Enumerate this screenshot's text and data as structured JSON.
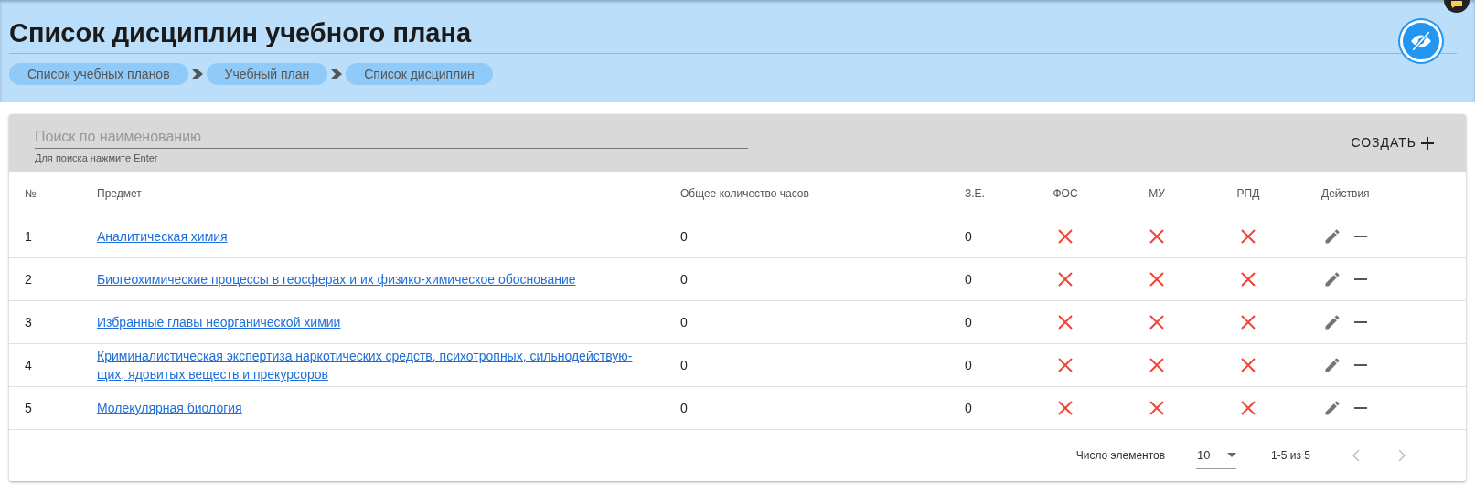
{
  "page_title": "Список дисциплин учебного плана",
  "breadcrumbs": [
    {
      "label": "Список учебных планов"
    },
    {
      "label": "Учебный план"
    },
    {
      "label": "Список дисциплин"
    }
  ],
  "search": {
    "placeholder": "Поиск по наименованию",
    "hint": "Для поиска нажмите Enter"
  },
  "create_button": "СОЗДАТЬ",
  "table": {
    "columns": [
      "№",
      "Предмет",
      "Общее количество часов",
      "З.Е.",
      "ФОС",
      "МУ",
      "РПД",
      "Действия"
    ],
    "rows": [
      {
        "number": "1",
        "subject": "Аналитическая химия",
        "hours": "0",
        "credits": "0",
        "fos": false,
        "mu": false,
        "rpd": false
      },
      {
        "number": "2",
        "subject": "Биогеохимические процессы в геосферах и их физико-химическое обоснование",
        "hours": "0",
        "credits": "0",
        "fos": false,
        "mu": false,
        "rpd": false
      },
      {
        "number": "3",
        "subject": "Избранные главы неорганической химии",
        "hours": "0",
        "credits": "0",
        "fos": false,
        "mu": false,
        "rpd": false
      },
      {
        "number": "4",
        "subject": "Криминалистическая экспертиза наркотических средств, психотропных, сильнодействую-щих, ядовитых веществ и прекурсоров",
        "hours": "0",
        "credits": "0",
        "fos": false,
        "mu": false,
        "rpd": false
      },
      {
        "number": "5",
        "subject": "Молекулярная биология",
        "hours": "0",
        "credits": "0",
        "fos": false,
        "mu": false,
        "rpd": false
      }
    ]
  },
  "pager": {
    "label": "Число элементов",
    "page_size": "10",
    "range": "1-5 из 5",
    "prev_disabled": true,
    "next_disabled": true
  }
}
